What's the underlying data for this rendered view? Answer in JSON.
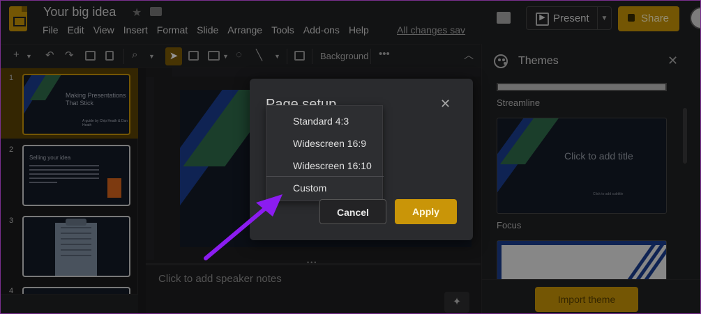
{
  "header": {
    "doc_title": "Your big idea",
    "menu": [
      "File",
      "Edit",
      "View",
      "Insert",
      "Format",
      "Slide",
      "Arrange",
      "Tools",
      "Add-ons",
      "Help"
    ],
    "changes_link": "All changes sav",
    "present_label": "Present",
    "share_label": "Share"
  },
  "toolbar": {
    "background_label": "Background",
    "more_label": "•••"
  },
  "filmstrip": {
    "slides": [
      {
        "number": "1",
        "title": "Making Presentations That Stick",
        "subtitle": "A guide by Chip Heath & Dan Heath"
      },
      {
        "number": "2",
        "title": "Selling your idea"
      },
      {
        "number": "3"
      },
      {
        "number": "4"
      }
    ]
  },
  "notes": {
    "placeholder": "Click to add speaker notes"
  },
  "themes_panel": {
    "title": "Themes",
    "themes": [
      {
        "name": "Streamline",
        "preview_title": "Click to add title",
        "preview_subtitle": "Click to add subtitle"
      },
      {
        "name": "Focus"
      }
    ],
    "import_label": "Import theme"
  },
  "dialog": {
    "title": "Page setup",
    "options": [
      "Standard 4:3",
      "Widescreen 16:9",
      "Widescreen 16:10",
      "Custom"
    ],
    "cancel_label": "Cancel",
    "apply_label": "Apply"
  },
  "colors": {
    "accent": "#c99508",
    "annotation_arrow": "#8b1cf0",
    "background": "#1b1b1d"
  }
}
